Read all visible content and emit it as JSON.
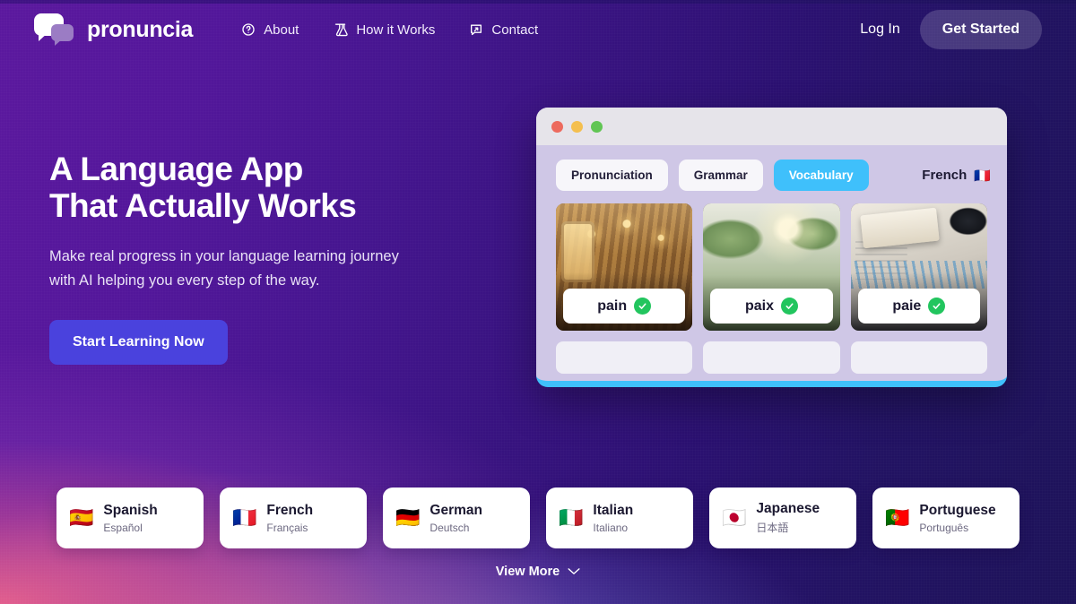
{
  "brand": {
    "name": "pronuncia",
    "logo_icon": "chat-bubbles-icon"
  },
  "nav": {
    "items": [
      {
        "label": "About",
        "icon": "question-circle-icon"
      },
      {
        "label": "How it Works",
        "icon": "flask-icon"
      },
      {
        "label": "Contact",
        "icon": "message-arrow-icon"
      }
    ],
    "login_label": "Log In",
    "get_started_label": "Get Started"
  },
  "hero": {
    "title_line1": "A Language App",
    "title_line2": "That Actually Works",
    "subtitle_line1": "Make real progress in your language learning journey",
    "subtitle_line2": "with AI helping you every step of the way.",
    "cta_label": "Start Learning Now",
    "cta_color": "#4a42dd"
  },
  "app_window": {
    "traffic_lights": [
      "#ed6a5e",
      "#f4bf4f",
      "#61c554"
    ],
    "tabs": [
      {
        "label": "Pronunciation",
        "active": false
      },
      {
        "label": "Grammar",
        "active": false
      },
      {
        "label": "Vocabulary",
        "active": true
      }
    ],
    "active_tab_color": "#3fc0fb",
    "language_indicator": {
      "label": "French",
      "flag": "🇫🇷"
    },
    "cards": [
      {
        "word": "pain",
        "status": "correct",
        "image": "bakery-bread-scene"
      },
      {
        "word": "paix",
        "status": "correct",
        "image": "peaceful-garden-scene"
      },
      {
        "word": "paie",
        "status": "correct",
        "image": "desk-paperwork-scene"
      }
    ],
    "status_color": "#22c55e",
    "empty_slots": 3
  },
  "languages": {
    "items": [
      {
        "flag": "🇪🇸",
        "english": "Spanish",
        "native": "Español"
      },
      {
        "flag": "🇫🇷",
        "english": "French",
        "native": "Français"
      },
      {
        "flag": "🇩🇪",
        "english": "German",
        "native": "Deutsch"
      },
      {
        "flag": "🇮🇹",
        "english": "Italian",
        "native": "Italiano"
      },
      {
        "flag": "🇯🇵",
        "english": "Japanese",
        "native": "日本語"
      },
      {
        "flag": "🇵🇹",
        "english": "Portuguese",
        "native": "Português"
      }
    ],
    "view_more_label": "View More",
    "view_more_icon": "chevron-down-icon"
  }
}
